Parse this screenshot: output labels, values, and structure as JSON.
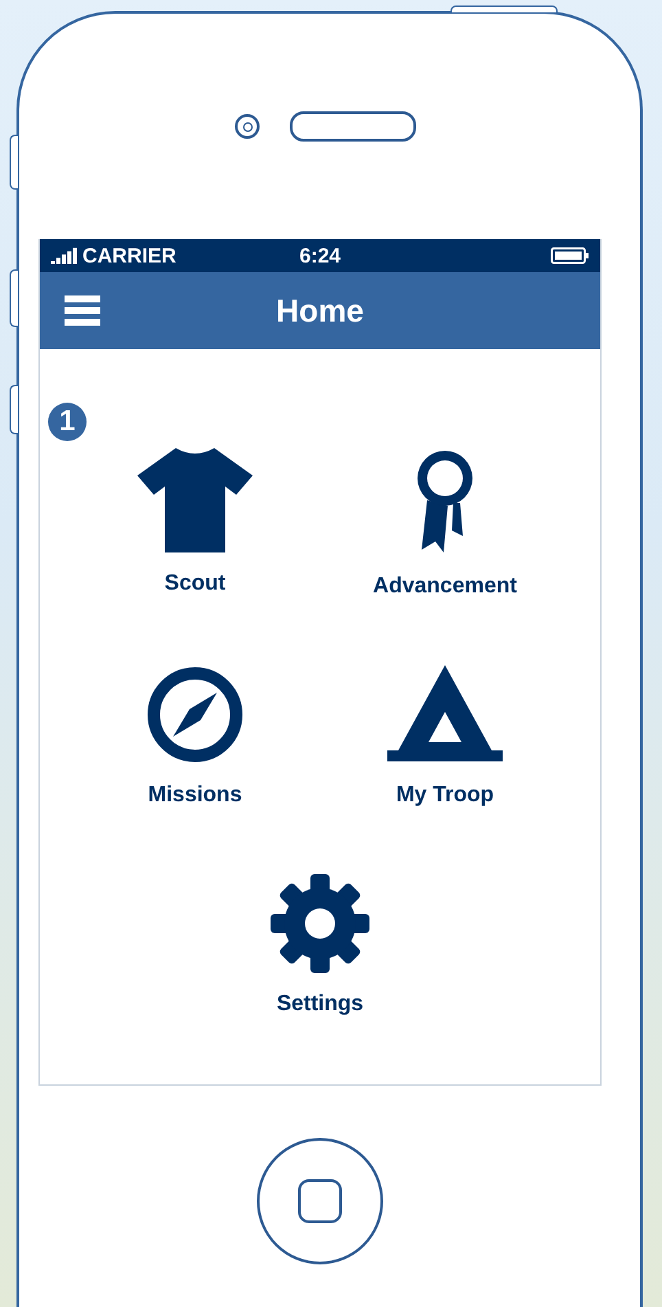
{
  "status_bar": {
    "carrier": "CARRIER",
    "time": "6:24"
  },
  "nav_bar": {
    "title": "Home"
  },
  "callout": "1",
  "menu": [
    {
      "label": "Scout",
      "kind": "shirt"
    },
    {
      "label": "Advancement",
      "kind": "ribbon"
    },
    {
      "label": "Missions",
      "kind": "compass"
    },
    {
      "label": "My Troop",
      "kind": "tent"
    },
    {
      "label": "Settings",
      "kind": "gear"
    }
  ]
}
